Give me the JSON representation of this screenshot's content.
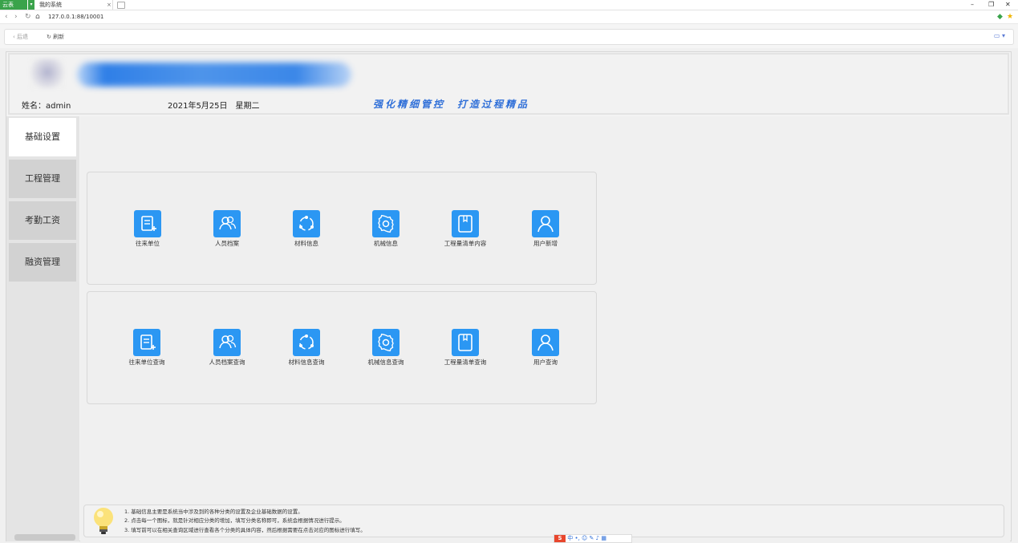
{
  "browser": {
    "brand_label": "云表",
    "tab_title": "我的系统",
    "tab_close": "×",
    "url": "127.0.0.1:88/10001",
    "back_label": "后退",
    "refresh_label": "刷新"
  },
  "header": {
    "user_label": "姓名：admin",
    "date_label": "2021年5月25日　星期二",
    "slogan": "强化精细管控　打造过程精品"
  },
  "sidebar": {
    "items": [
      {
        "label": "基础设置",
        "active": true
      },
      {
        "label": "工程管理",
        "active": false
      },
      {
        "label": "考勤工资",
        "active": false
      },
      {
        "label": "融资管理",
        "active": false
      }
    ]
  },
  "panels": [
    {
      "tiles": [
        {
          "label": "往来单位",
          "icon": "document-add-icon"
        },
        {
          "label": "人员档案",
          "icon": "users-icon"
        },
        {
          "label": "材料信息",
          "icon": "cycle-icon"
        },
        {
          "label": "机械信息",
          "icon": "gear-icon"
        },
        {
          "label": "工程量清单内容",
          "icon": "book-icon"
        },
        {
          "label": "用户新增",
          "icon": "user-icon"
        }
      ]
    },
    {
      "tiles": [
        {
          "label": "往来单位查询",
          "icon": "document-add-icon"
        },
        {
          "label": "人员档案查询",
          "icon": "users-icon"
        },
        {
          "label": "材料信息查询",
          "icon": "cycle-icon"
        },
        {
          "label": "机械信息查询",
          "icon": "gear-icon"
        },
        {
          "label": "工程量清单查询",
          "icon": "book-icon"
        },
        {
          "label": "用户查询",
          "icon": "user-icon"
        }
      ]
    }
  ],
  "tips": [
    "1. 基础信息主要是系统当中涉及到的各种分类的设置及企业基础数据的设置。",
    "2. 点击每一个图标，就是针对相应分类的增加，填写分类名称即可，系统会根据情况进行提示。",
    "3. 填写前可以在相关查询区域进行查看各个分类的具体内容，然后根据需要在点击对应的图标进行填写。"
  ],
  "ime": {
    "logo": "S",
    "text": "中 •, ☺ ✎ ♪ ▦"
  },
  "colors": {
    "accent": "#2b97f3",
    "slogan": "#2f6fd8",
    "brand": "#3aa34b"
  }
}
